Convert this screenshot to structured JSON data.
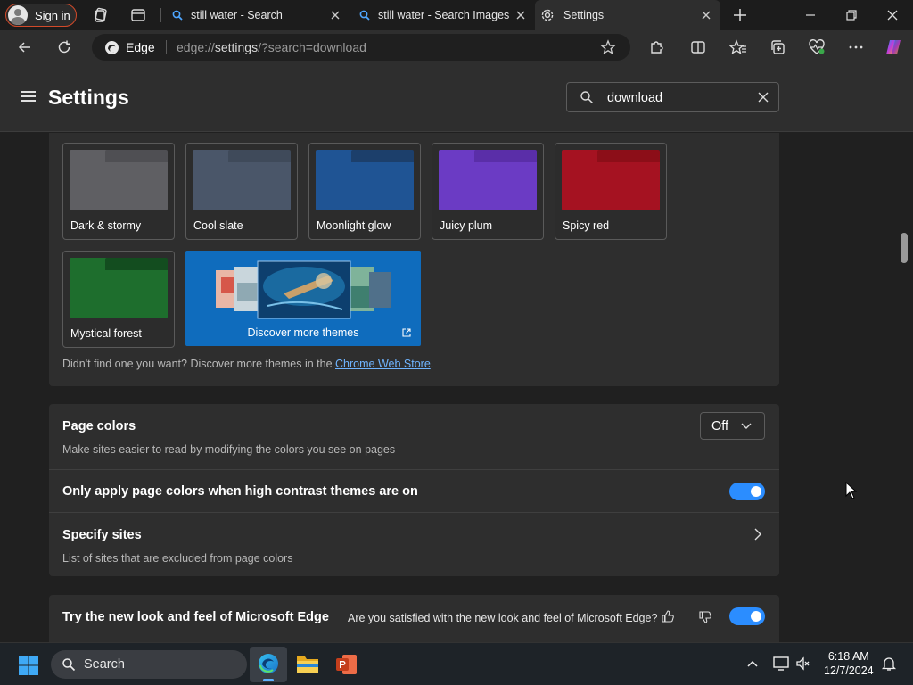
{
  "browser": {
    "signin_label": "Sign in",
    "tabs": [
      {
        "title": "still water - Search"
      },
      {
        "title": "still water - Search Images"
      },
      {
        "title": "Settings"
      }
    ],
    "address": {
      "site_label": "Edge",
      "url_scheme": "edge://",
      "url_path": "settings",
      "url_query": "/?search=download"
    }
  },
  "settings": {
    "title": "Settings",
    "search_value": "download",
    "themes": [
      {
        "label": "Dark & stormy",
        "color_dark": "#4f4f53",
        "color_light": "#5f5f63"
      },
      {
        "label": "Cool slate",
        "color_dark": "#3f4a5a",
        "color_light": "#4a5669"
      },
      {
        "label": "Moonlight glow",
        "color_dark": "#1c3f6b",
        "color_light": "#1f5494"
      },
      {
        "label": "Juicy plum",
        "color_dark": "#5a2ea8",
        "color_light": "#6b3bc4"
      },
      {
        "label": "Spicy red",
        "color_dark": "#8c0e18",
        "color_light": "#a51221"
      },
      {
        "label": "Mystical forest",
        "color_dark": "#134d1f",
        "color_light": "#1e6e2d"
      }
    ],
    "discover_label": "Discover more themes",
    "store_note_prefix": "Didn't find one you want? Discover more themes in the ",
    "store_link": "Chrome Web Store",
    "store_note_suffix": ".",
    "page_colors": {
      "title": "Page colors",
      "description": "Make sites easier to read by modifying the colors you see on pages",
      "value": "Off"
    },
    "high_contrast_only": {
      "title": "Only apply page colors when high contrast themes are on",
      "enabled": true
    },
    "specify_sites": {
      "title": "Specify sites",
      "description": "List of sites that are excluded from page colors"
    },
    "new_look": {
      "title": "Try the new look and feel of Microsoft Edge",
      "question": "Are you satisfied with the new look and feel of Microsoft Edge?",
      "enabled": true
    }
  },
  "taskbar": {
    "search_label": "Search",
    "time": "6:18 AM",
    "date": "12/7/2024"
  },
  "colors": {
    "accent": "#2b8dff",
    "discover_tile": "#0f6cbd"
  }
}
